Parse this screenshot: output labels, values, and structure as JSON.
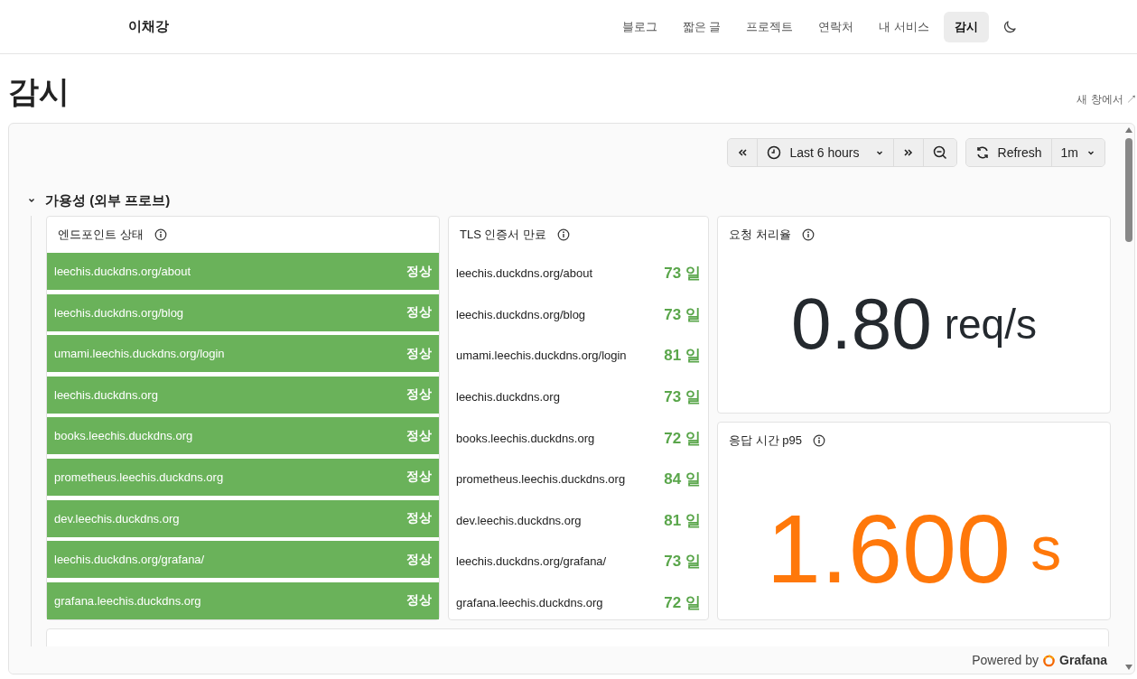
{
  "site": {
    "name": "이채강"
  },
  "nav": [
    {
      "label": "블로그",
      "selected": false
    },
    {
      "label": "짧은 글",
      "selected": false
    },
    {
      "label": "프로젝트",
      "selected": false
    },
    {
      "label": "연락처",
      "selected": false
    },
    {
      "label": "내 서비스",
      "selected": false
    },
    {
      "label": "감시",
      "selected": true
    }
  ],
  "page": {
    "title": "감시",
    "open_link": "새 창에서 ↗"
  },
  "toolbar": {
    "time_range": "Last 6 hours",
    "refresh": "Refresh",
    "interval": "1m"
  },
  "section": {
    "title": "가용성 (외부 프로브)",
    "expanded": true
  },
  "endpoints": {
    "title": "엔드포인트 상태",
    "rows": [
      {
        "url": "leechis.duckdns.org/about",
        "status": "정상",
        "up": true
      },
      {
        "url": "leechis.duckdns.org/blog",
        "status": "정상",
        "up": true
      },
      {
        "url": "umami.leechis.duckdns.org/login",
        "status": "정상",
        "up": true
      },
      {
        "url": "leechis.duckdns.org",
        "status": "정상",
        "up": true
      },
      {
        "url": "books.leechis.duckdns.org",
        "status": "정상",
        "up": true
      },
      {
        "url": "prometheus.leechis.duckdns.org",
        "status": "정상",
        "up": true
      },
      {
        "url": "dev.leechis.duckdns.org",
        "status": "정상",
        "up": true
      },
      {
        "url": "leechis.duckdns.org/grafana/",
        "status": "정상",
        "up": true
      },
      {
        "url": "grafana.leechis.duckdns.org",
        "status": "정상",
        "up": true
      }
    ]
  },
  "tls": {
    "title": "TLS 인증서 만료",
    "rows": [
      {
        "host": "leechis.duckdns.org/about",
        "days": "73 일"
      },
      {
        "host": "leechis.duckdns.org/blog",
        "days": "73 일"
      },
      {
        "host": "umami.leechis.duckdns.org/login",
        "days": "81 일"
      },
      {
        "host": "leechis.duckdns.org",
        "days": "73 일"
      },
      {
        "host": "books.leechis.duckdns.org",
        "days": "72 일"
      },
      {
        "host": "prometheus.leechis.duckdns.org",
        "days": "84 일"
      },
      {
        "host": "dev.leechis.duckdns.org",
        "days": "81 일"
      },
      {
        "host": "leechis.duckdns.org/grafana/",
        "days": "73 일"
      },
      {
        "host": "grafana.leechis.duckdns.org",
        "days": "72 일"
      }
    ]
  },
  "stats": [
    {
      "title": "요청 처리율",
      "value": "0.80",
      "unit": "req/s",
      "color": "#24292e"
    },
    {
      "title": "응답 시간 p95",
      "value": "1.600",
      "unit": "s",
      "color": "#ff780a"
    }
  ],
  "footer": {
    "powered_by": "Powered by",
    "brand": "Grafana"
  }
}
